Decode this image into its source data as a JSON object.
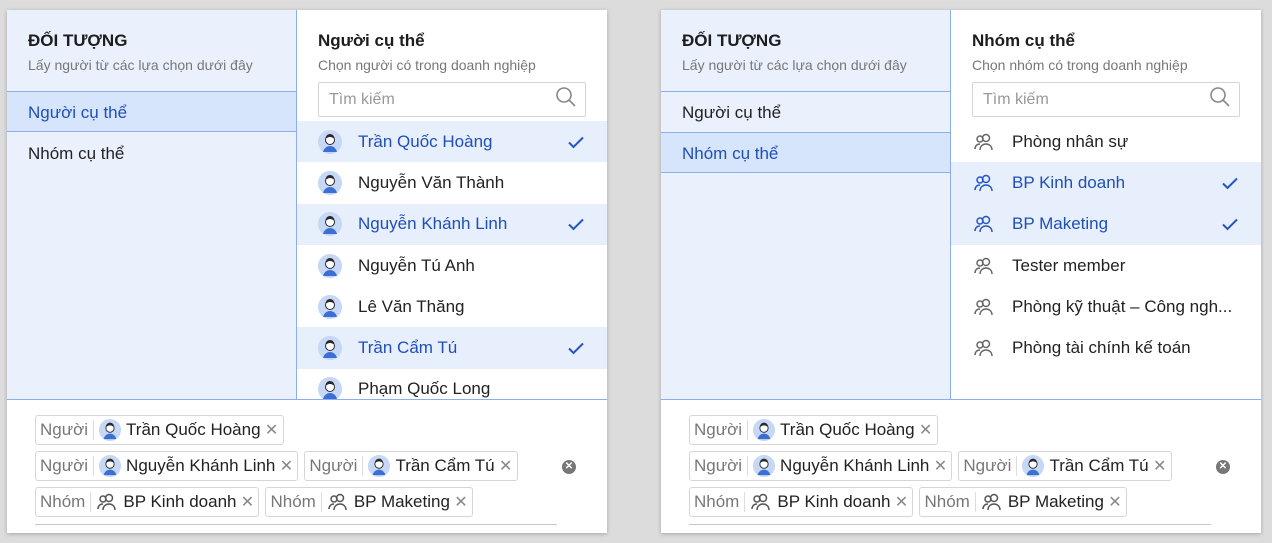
{
  "colors": {
    "accent": "#1f4fb8",
    "selected_bg": "#e7eefc",
    "left_bg": "#eaf1fd"
  },
  "left_panel": {
    "sidebar": {
      "title": "ĐỐI TƯỢNG",
      "subtitle": "Lấy người từ các lựa chọn dưới đây",
      "items": [
        {
          "label": "Người cụ thể",
          "active": true
        },
        {
          "label": "Nhóm cụ thể",
          "active": false
        }
      ]
    },
    "picker": {
      "title": "Người cụ thể",
      "subtitle": "Chọn người có trong doanh nghiệp",
      "search_placeholder": "Tìm kiếm",
      "rows": [
        {
          "label": "Trần Quốc Hoàng",
          "selected": true
        },
        {
          "label": "Nguyễn Văn Thành",
          "selected": false
        },
        {
          "label": "Nguyễn Khánh Linh",
          "selected": true
        },
        {
          "label": "Nguyễn Tú Anh",
          "selected": false
        },
        {
          "label": "Lê Văn Thăng",
          "selected": false
        },
        {
          "label": "Trần Cẩm Tú",
          "selected": true
        },
        {
          "label": "Phạm Quốc Long",
          "selected": false
        }
      ]
    },
    "chips": [
      {
        "type": "Người",
        "name": "Trần Quốc Hoàng"
      },
      {
        "type": "Người",
        "name": "Nguyễn Khánh Linh"
      },
      {
        "type": "Người",
        "name": "Trần Cẩm Tú"
      },
      {
        "type": "Nhóm",
        "name": "BP Kinh doanh"
      },
      {
        "type": "Nhóm",
        "name": "BP Maketing"
      }
    ]
  },
  "right_panel": {
    "sidebar": {
      "title": "ĐỐI TƯỢNG",
      "subtitle": "Lấy người từ các lựa chọn dưới đây",
      "items": [
        {
          "label": "Người cụ thể",
          "active": false
        },
        {
          "label": "Nhóm cụ thể",
          "active": true
        }
      ]
    },
    "picker": {
      "title": "Nhóm cụ thể",
      "subtitle": "Chọn nhóm có trong doanh nghiệp",
      "search_placeholder": "Tìm kiếm",
      "rows": [
        {
          "label": "Phòng nhân sự",
          "selected": false
        },
        {
          "label": "BP Kinh doanh",
          "selected": true
        },
        {
          "label": "BP Maketing",
          "selected": true
        },
        {
          "label": "Tester member",
          "selected": false
        },
        {
          "label": "Phòng kỹ thuật – Công ngh...",
          "selected": false
        },
        {
          "label": "Phòng tài chính kế toán",
          "selected": false
        }
      ]
    },
    "chips": [
      {
        "type": "Người",
        "name": "Trần Quốc Hoàng"
      },
      {
        "type": "Người",
        "name": "Nguyễn Khánh Linh"
      },
      {
        "type": "Người",
        "name": "Trần Cẩm Tú"
      },
      {
        "type": "Nhóm",
        "name": "BP Kinh doanh"
      },
      {
        "type": "Nhóm",
        "name": "BP Maketing"
      }
    ]
  }
}
